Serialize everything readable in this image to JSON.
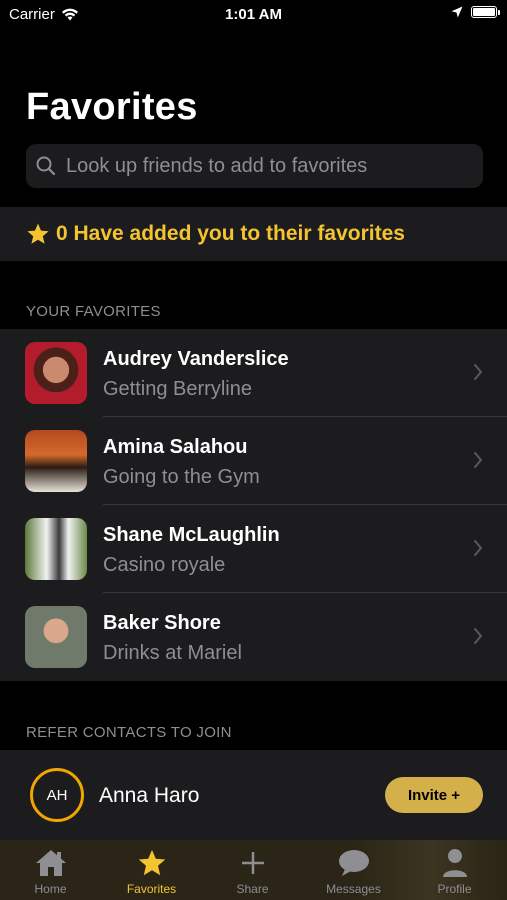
{
  "status_bar": {
    "carrier": "Carrier",
    "time": "1:01 AM"
  },
  "page": {
    "title": "Favorites"
  },
  "search": {
    "placeholder": "Look up friends to add to favorites"
  },
  "banner": {
    "text": "0 Have added you to their favorites"
  },
  "sections": {
    "favorites_header": "YOUR FAVORITES",
    "refer_header": "REFER CONTACTS TO JOIN"
  },
  "favorites": [
    {
      "name": "Audrey Vanderslice",
      "status": "Getting Berryline"
    },
    {
      "name": "Amina Salahou",
      "status": "Going to the Gym"
    },
    {
      "name": "Shane McLaughlin",
      "status": "Casino royale"
    },
    {
      "name": "Baker Shore",
      "status": "Drinks at Mariel"
    }
  ],
  "contacts": [
    {
      "initials": "AH",
      "name": "Anna Haro",
      "invite_label": "Invite +"
    }
  ],
  "tabs": [
    {
      "label": "Home",
      "icon": "home-icon"
    },
    {
      "label": "Favorites",
      "icon": "star-icon"
    },
    {
      "label": "Share",
      "icon": "plus-icon"
    },
    {
      "label": "Messages",
      "icon": "chat-bubble-icon"
    },
    {
      "label": "Profile",
      "icon": "person-icon"
    }
  ],
  "colors": {
    "accent": "#f4c430",
    "background": "#000000",
    "surface": "#1c1c1e",
    "secondary_text": "#8e8e93",
    "invite_button": "#d4b04a"
  }
}
